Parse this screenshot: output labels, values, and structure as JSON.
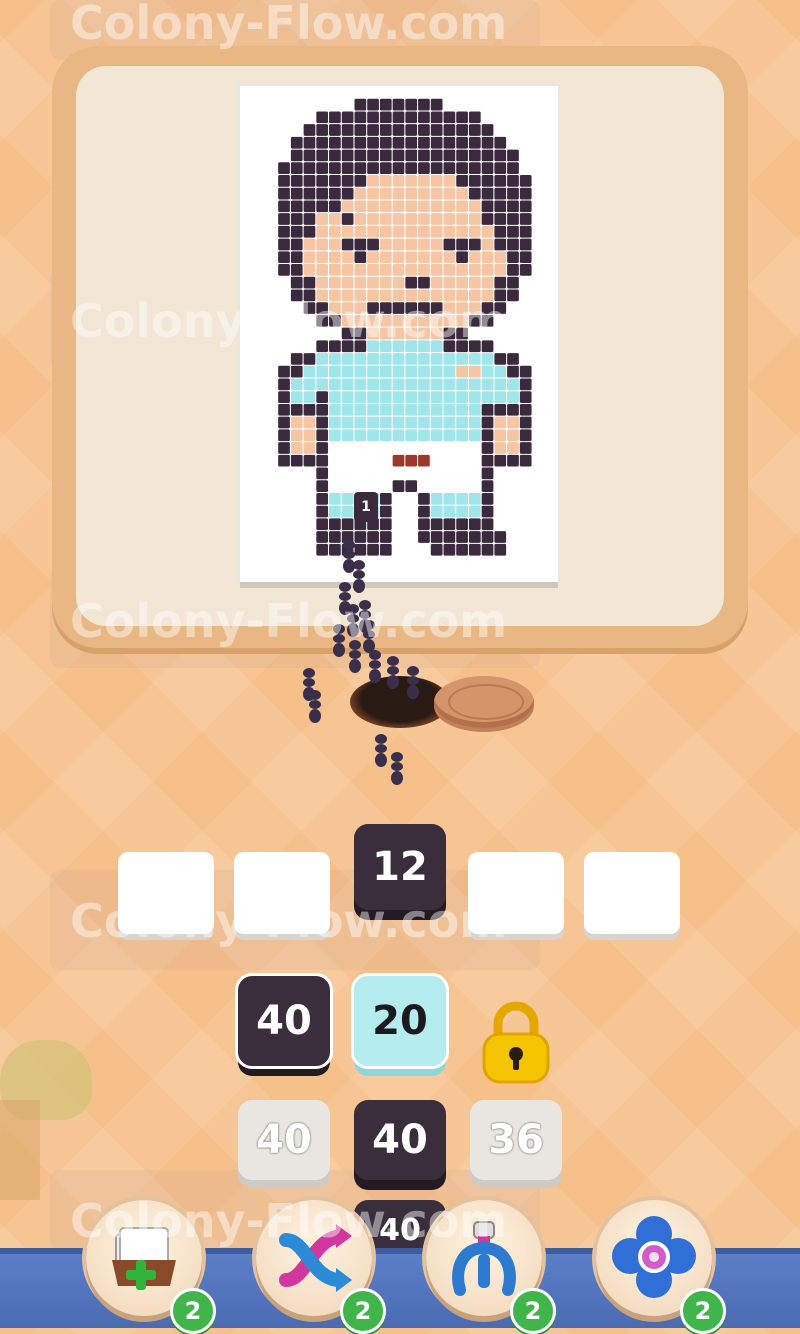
{
  "watermark": "Colony-Flow.com",
  "grid": {
    "cols": 25,
    "rows": 39,
    "palette": {
      "W": "#ffffff",
      "D": "#3b2a3d",
      "S": "#f6c5a3",
      "L": "#9fe5ea",
      "R": "#9b3a2a"
    },
    "pixels": [
      "WWWWWWWWWWWWWWWWWWWWWWWWW",
      "WWWWWWWWWDDDDDDDWWWWWWWWW",
      "WWWWWWDDDDDDDDDDDDDWWWWWW",
      "WWWWWDDDDDDDDDDDDDDDWWWWW",
      "WWWWDDDDDDDDDDDDDDDDDWWWW",
      "WWWWDDDDDDDDDDDDDDDDDDWWW",
      "WWWDDDDDDDDDDDDDDDDDDDWWW",
      "WWWDDDDDDDSSSSSSSDDDDDDWW",
      "WWWDDDDDDSSSSSSSSSDDDDDWW",
      "WWWDDDDDSSSSSSSSSSSDDDDWW",
      "WWWDDDSSDSSSSSSSSSSDDDDWW",
      "WWWDDDSSSSSSSSSSSSSSDDDWW",
      "WWWDDSSSDDDSSSSSDDDSDDDWW",
      "WWWDDSSSSDSSSSSSSDSSSDDWW",
      "WWWDDSSSSSSSSSSSSSSSSDDWW",
      "WWWWDDSSSSSSSDDSSSSSDDWWW",
      "WWWWDDSSSSSSSSSSSSSSDDWWW",
      "WWWWWDDSSSDDDDDDSSSDDWWWW",
      "WWWWWWDDSSSSSSSSSSDDWWWWW",
      "WWWWWWWWDDSSSSSSDDWWWWWWW",
      "WWWWWWDDDDLLLLLLDDDDWWWWW",
      "WWWWDDLLLLLLLLLLLLLLDDWWW",
      "WWWDDLLLLLLLLLLLLSSLLDDWW",
      "WWWDLLLLLLLLLLLLLLLLLLDWW",
      "WWWDLLDLLLLLLLLLLLLLLLDWW",
      "WWWDDDDLLLLLLLLLLLLDDDDWW",
      "WWWDSSDLLLLLLLLLLLLDSSDWW",
      "WWWDSSDLLLLLLLLLLLLDSSDWW",
      "WWWDSSDWWWWWWWWWWWWDSSDWW",
      "WWWDDDDWWWWWRRRWWWWDDDDWW",
      "WWWWWWDWWWWWWWWWWWWDWWWWW",
      "WWWWWWDWWWWWDDWWWWWDWWWWW",
      "WWWWWWDLLLLDWWDLLLLDWWWWW",
      "WWWWWWDLLLLDWWDLLLLDWWWWW",
      "WWWWWWDDDDDDWWDDDDDDWWWWW",
      "WWWWWWDDDDDDWWDDDDDDDWWWW",
      "WWWWWWDDDDDDWWWDDDDDDWWWW",
      "WWWWWWWWWWWWWWWWWWWWWWWWW",
      "WWWWWWWWWWWWWWWWWWWWWWWWW"
    ]
  },
  "marker_number": "1",
  "queue_slots": {
    "active_value": "12"
  },
  "tiles": {
    "row1": [
      "40",
      "20"
    ],
    "row2": [
      "40",
      "40",
      "36"
    ],
    "row3_partial": "40"
  },
  "boosters": [
    {
      "name": "add-slot",
      "count": "2",
      "icon": "tray-plus-icon"
    },
    {
      "name": "shuffle",
      "count": "2",
      "icon": "shuffle-arrows-icon"
    },
    {
      "name": "magnet",
      "count": "2",
      "icon": "magnet-claw-icon"
    },
    {
      "name": "flower",
      "count": "2",
      "icon": "flower-gear-icon"
    }
  ],
  "colors": {
    "background": "#f6c08b",
    "dark_tile": "#3a2e3c",
    "light_tile": "#b5ecef",
    "badge": "#3fb54a",
    "bottom_bar": "#5b7fc8"
  }
}
